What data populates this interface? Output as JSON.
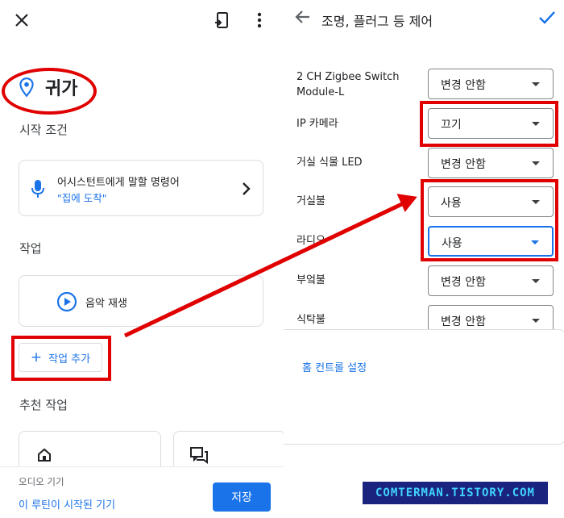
{
  "routine_editor": {
    "title": "귀가",
    "starter_section_label": "시작 조건",
    "starter": {
      "line1": "어시스턴트에게 말할 명령어",
      "line2": "\"집에 도착\""
    },
    "actions_section_label": "작업",
    "action_item": "음악 재생",
    "add_action_label": "작업 추가",
    "suggested_section_label": "추천 작업",
    "bottom": {
      "label": "오디오 기기",
      "link": "이 루틴이 시작된 기기",
      "save_label": "저장"
    }
  },
  "device_control": {
    "title": "조명, 플러그 등 제어",
    "devices": [
      {
        "name": "2 CH Zigbee Switch Module-L",
        "value": "변경 안함"
      },
      {
        "name": "IP 카메라",
        "value": "끄기"
      },
      {
        "name": "거실 식물 LED",
        "value": "변경 안함"
      },
      {
        "name": "거실불",
        "value": "사용"
      },
      {
        "name": "라디오",
        "value": "사용"
      },
      {
        "name": "부엌불",
        "value": "변경 안함"
      },
      {
        "name": "식탁불",
        "value": "변경 안함"
      }
    ],
    "home_settings_link": "홈 컨트롤 설정"
  },
  "watermark": "COMTERMAN.TISTORY.COM",
  "colors": {
    "accent": "#1a73e8",
    "highlight": "#e00000",
    "watermark_bg": "#1a237e",
    "watermark_text": "#42d4ff"
  },
  "icons": [
    "close-icon",
    "cast-icon",
    "more-icon",
    "location-pin-icon",
    "mic-icon",
    "chevron-right-icon",
    "play-icon",
    "plus-icon",
    "home-icon",
    "chat-icon",
    "back-arrow-icon",
    "check-icon",
    "dropdown-arrow-icon"
  ]
}
